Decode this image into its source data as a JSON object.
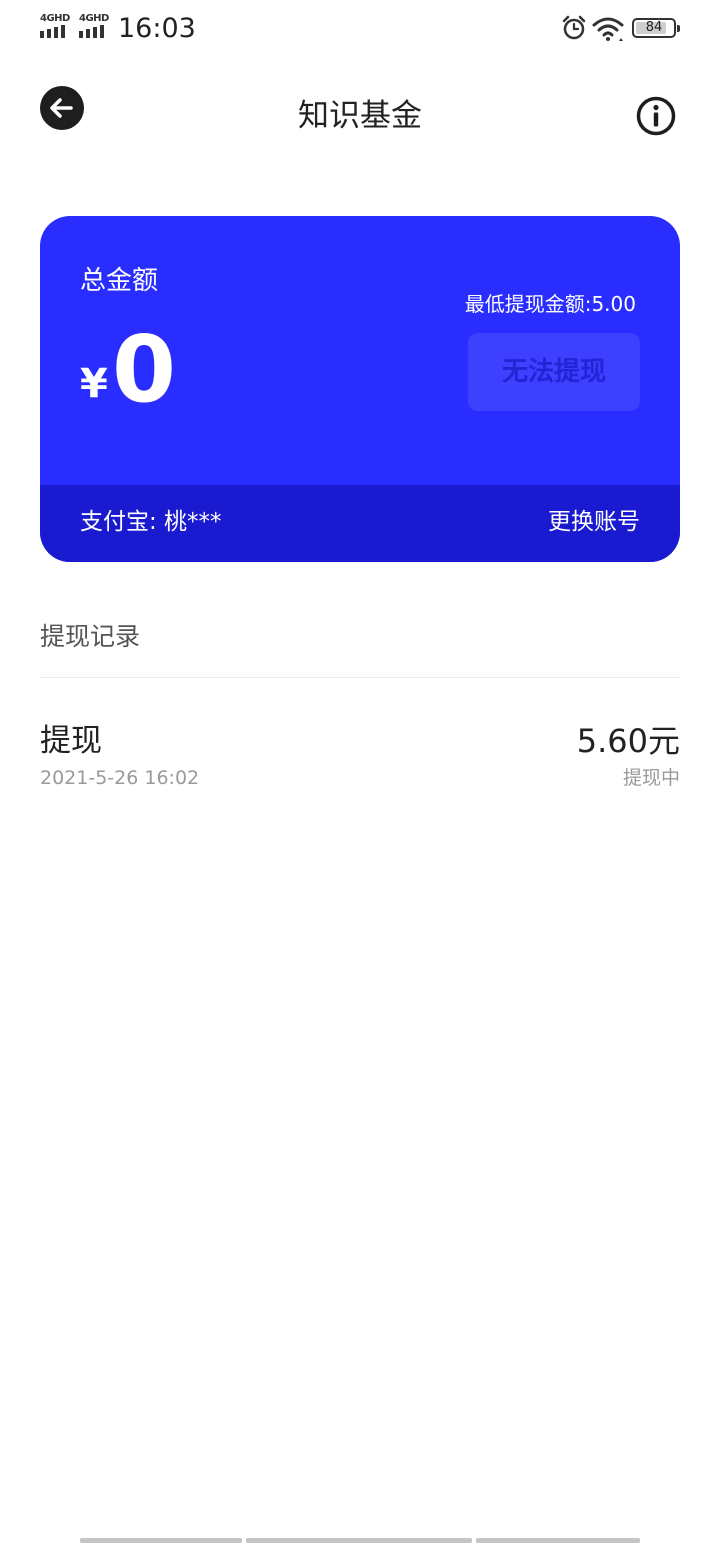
{
  "status_bar": {
    "sim1_label": "4GHD",
    "sim2_label": "4GHD",
    "time": "16:03",
    "battery_level": "84",
    "icons": [
      "signal-icon",
      "alarm-icon",
      "wifi-icon",
      "battery-icon"
    ]
  },
  "header": {
    "title": "知识基金",
    "back_icon": "arrow-left-icon",
    "info_icon": "info-icon"
  },
  "balance_card": {
    "label": "总金额",
    "currency": "¥",
    "amount": "0",
    "min_withdraw": "最低提现金额:5.00",
    "withdraw_button": "无法提现",
    "account": "支付宝: 桃***",
    "change_account": "更换账号",
    "colors": {
      "card_bg": "#2a2dff",
      "footer_bg": "#1a1ad0",
      "button_bg": "#3d40ff",
      "button_text": "#2324d6"
    }
  },
  "records": {
    "heading": "提现记录",
    "items": [
      {
        "title": "提现",
        "date": "2021-5-26 16:02",
        "amount": "5.60元",
        "status": "提现中"
      }
    ]
  }
}
